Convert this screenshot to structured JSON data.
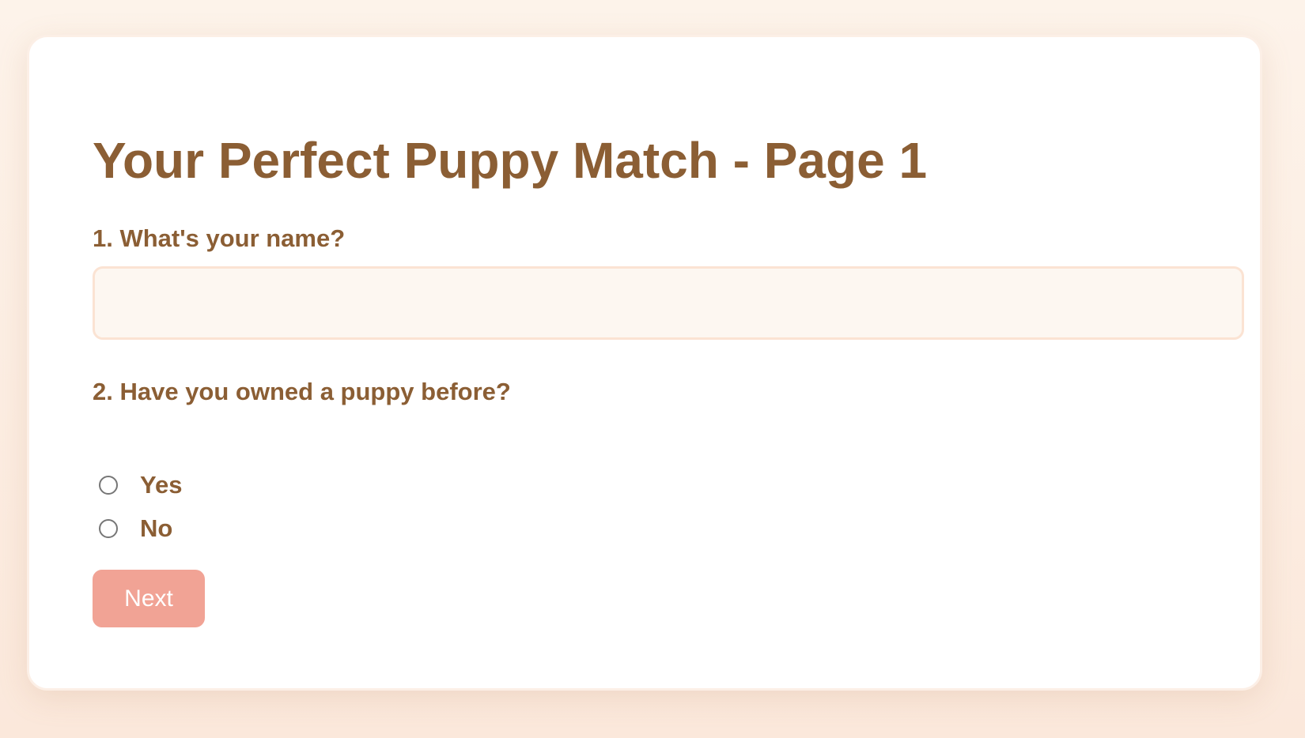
{
  "form": {
    "title": "Your Perfect Puppy Match - Page 1",
    "question1": {
      "label": "1. What's your name?",
      "value": "",
      "placeholder": ""
    },
    "question2": {
      "label": "2. Have you owned a puppy before?",
      "options": [
        {
          "label": "Yes",
          "selected": false
        },
        {
          "label": "No",
          "selected": false
        }
      ]
    },
    "next_label": "Next"
  },
  "colors": {
    "text": "#8b5e34",
    "button": "#f1a395",
    "input_bg": "#fdf7f1",
    "input_border": "#fbe3d3",
    "page_bg": "#fdf1e7"
  }
}
